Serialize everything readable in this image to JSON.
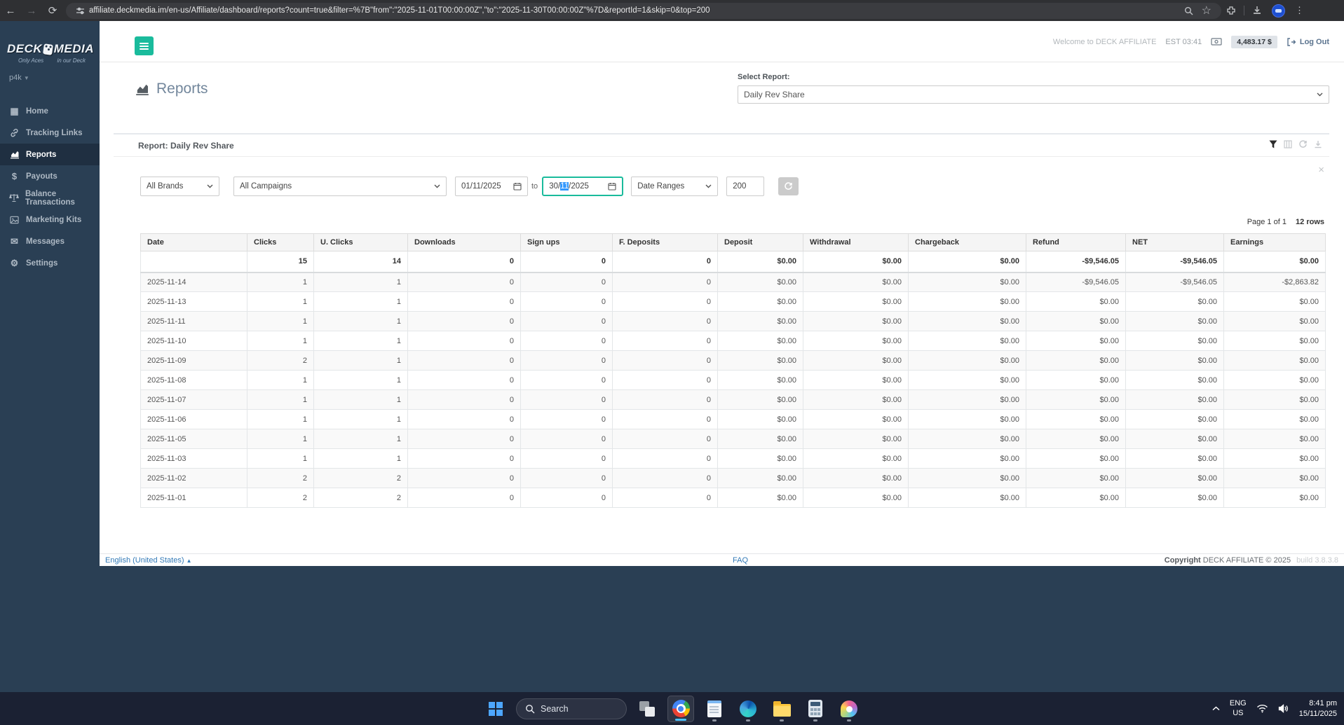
{
  "browser": {
    "url": "affiliate.deckmedia.im/en-us/Affiliate/dashboard/reports?count=true&filter=%7B\"from\":\"2025-11-01T00:00:00Z\",\"to\":\"2025-11-30T00:00:00Z\"%7D&reportId=1&skip=0&top=200"
  },
  "header": {
    "welcome": "Welcome to DECK AFFILIATE",
    "time": "EST 03:41",
    "balance": "4,483.17 $",
    "logout_label": "Log Out"
  },
  "sidebar": {
    "brand_left": "DECK",
    "brand_right": "MEDIA",
    "tagline_left": "Only Aces",
    "tagline_right": "in our Deck",
    "account": "p4k",
    "items": [
      {
        "label": "Home"
      },
      {
        "label": "Tracking Links"
      },
      {
        "label": "Reports"
      },
      {
        "label": "Payouts"
      },
      {
        "label": "Balance Transactions"
      },
      {
        "label": "Marketing Kits"
      },
      {
        "label": "Messages"
      },
      {
        "label": "Settings"
      }
    ]
  },
  "main": {
    "page_title": "Reports",
    "select_report_label": "Select Report:",
    "selected_report": "Daily Rev Share",
    "report_heading": "Report: Daily Rev Share",
    "filters": {
      "brands": "All Brands",
      "campaigns": "All Campaigns",
      "date_from": "01/11/2025",
      "to_label": "to",
      "date_to_prefix": "30/",
      "date_to_selected": "11",
      "date_to_suffix": "/2025",
      "date_ranges": "Date Ranges",
      "rows_limit": "200"
    },
    "pagination": {
      "page": "Page 1 of 1",
      "rows": "12 rows"
    }
  },
  "table": {
    "columns": [
      "Date",
      "Clicks",
      "U. Clicks",
      "Downloads",
      "Sign ups",
      "F. Deposits",
      "Deposit",
      "Withdrawal",
      "Chargeback",
      "Refund",
      "NET",
      "Earnings"
    ],
    "totals": [
      "",
      "15",
      "14",
      "0",
      "0",
      "0",
      "$0.00",
      "$0.00",
      "$0.00",
      "-$9,546.05",
      "-$9,546.05",
      "$0.00"
    ],
    "rows": [
      [
        "2025-11-14",
        "1",
        "1",
        "0",
        "0",
        "0",
        "$0.00",
        "$0.00",
        "$0.00",
        "-$9,546.05",
        "-$9,546.05",
        "-$2,863.82"
      ],
      [
        "2025-11-13",
        "1",
        "1",
        "0",
        "0",
        "0",
        "$0.00",
        "$0.00",
        "$0.00",
        "$0.00",
        "$0.00",
        "$0.00"
      ],
      [
        "2025-11-11",
        "1",
        "1",
        "0",
        "0",
        "0",
        "$0.00",
        "$0.00",
        "$0.00",
        "$0.00",
        "$0.00",
        "$0.00"
      ],
      [
        "2025-11-10",
        "1",
        "1",
        "0",
        "0",
        "0",
        "$0.00",
        "$0.00",
        "$0.00",
        "$0.00",
        "$0.00",
        "$0.00"
      ],
      [
        "2025-11-09",
        "2",
        "1",
        "0",
        "0",
        "0",
        "$0.00",
        "$0.00",
        "$0.00",
        "$0.00",
        "$0.00",
        "$0.00"
      ],
      [
        "2025-11-08",
        "1",
        "1",
        "0",
        "0",
        "0",
        "$0.00",
        "$0.00",
        "$0.00",
        "$0.00",
        "$0.00",
        "$0.00"
      ],
      [
        "2025-11-07",
        "1",
        "1",
        "0",
        "0",
        "0",
        "$0.00",
        "$0.00",
        "$0.00",
        "$0.00",
        "$0.00",
        "$0.00"
      ],
      [
        "2025-11-06",
        "1",
        "1",
        "0",
        "0",
        "0",
        "$0.00",
        "$0.00",
        "$0.00",
        "$0.00",
        "$0.00",
        "$0.00"
      ],
      [
        "2025-11-05",
        "1",
        "1",
        "0",
        "0",
        "0",
        "$0.00",
        "$0.00",
        "$0.00",
        "$0.00",
        "$0.00",
        "$0.00"
      ],
      [
        "2025-11-03",
        "1",
        "1",
        "0",
        "0",
        "0",
        "$0.00",
        "$0.00",
        "$0.00",
        "$0.00",
        "$0.00",
        "$0.00"
      ],
      [
        "2025-11-02",
        "2",
        "2",
        "0",
        "0",
        "0",
        "$0.00",
        "$0.00",
        "$0.00",
        "$0.00",
        "$0.00",
        "$0.00"
      ],
      [
        "2025-11-01",
        "2",
        "2",
        "0",
        "0",
        "0",
        "$0.00",
        "$0.00",
        "$0.00",
        "$0.00",
        "$0.00",
        "$0.00"
      ]
    ]
  },
  "footer": {
    "language": "English (United States)",
    "faq": "FAQ",
    "copyright_label": "Copyright",
    "copyright_text": "DECK AFFILIATE © 2025",
    "build": "build 3.8.3.8"
  },
  "taskbar": {
    "search_placeholder": "Search",
    "lang_top": "ENG",
    "lang_bottom": "US",
    "time": "8:41 pm",
    "date": "15/11/2025"
  },
  "colors": {
    "accent_green": "#1ABB9C",
    "sidebar_bg": "#2A3F54",
    "link_blue": "#337ab7",
    "selection_blue": "#3297fd",
    "taskbar_accent": "#4cc2ff"
  }
}
